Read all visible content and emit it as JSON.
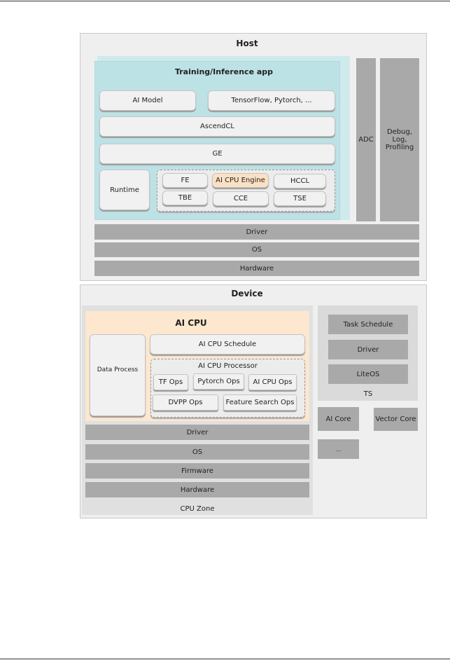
{
  "host": {
    "title": "Host",
    "app_title": "Training/Inference app",
    "ai_model": "AI Model",
    "frameworks": "TensorFlow, Pytorch, ...",
    "ascendcl": "AscendCL",
    "ge": "GE",
    "runtime": "Runtime",
    "fe": "FE",
    "ai_cpu_engine": "AI CPU Engine",
    "hccl": "HCCL",
    "tbe": "TBE",
    "cce": "CCE",
    "tse": "TSE",
    "adc": "ADC",
    "debug": "Debug, Log, Profiling",
    "driver": "Driver",
    "os": "OS",
    "hardware": "Hardware"
  },
  "device": {
    "title": "Device",
    "ai_cpu_title": "AI CPU",
    "data_process": "Data Process",
    "ai_cpu_schedule": "AI CPU Schedule",
    "ai_cpu_processor": "AI CPU Processor",
    "tf_ops": "TF Ops",
    "pytorch_ops": "Pytorch Ops",
    "ai_cpu_ops": "AI CPU Ops",
    "dvpp_ops": "DVPP Ops",
    "feature_search_ops": "Feature Search Ops",
    "driver": "Driver",
    "os": "OS",
    "firmware": "Firmware",
    "hardware": "Hardware",
    "cpu_zone": "CPU Zone",
    "task_schedule": "Task Schedule",
    "ts_driver": "Driver",
    "liteos": "LiteOS",
    "ts": "TS",
    "ai_core": "AI Core",
    "vector_core": "Vector Core",
    "more": "..."
  },
  "colors": {
    "teal": "#bde2e5",
    "orange": "#fde7cf",
    "grey_bar": "#a9a9a9"
  }
}
